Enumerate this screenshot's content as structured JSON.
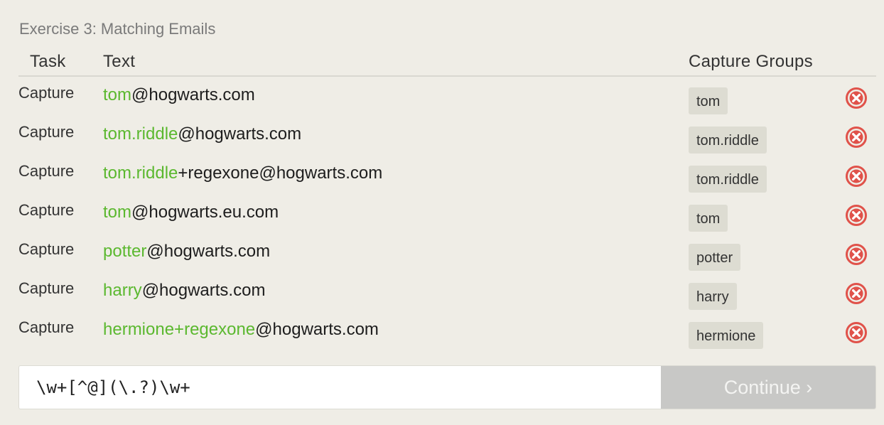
{
  "exercise": {
    "title": "Exercise 3: Matching Emails"
  },
  "table": {
    "headers": {
      "task": "Task",
      "text": "Text",
      "groups": "Capture Groups"
    },
    "rows": [
      {
        "task": "Capture",
        "match": "tom",
        "rest": "@hogwarts.com",
        "group": "tom",
        "status": "error"
      },
      {
        "task": "Capture",
        "match": "tom.riddle",
        "rest": "@hogwarts.com",
        "group": "tom.riddle",
        "status": "error"
      },
      {
        "task": "Capture",
        "match": "tom.riddle",
        "rest": "+regexone@hogwarts.com",
        "group": "tom.riddle",
        "status": "error"
      },
      {
        "task": "Capture",
        "match": "tom",
        "rest": "@hogwarts.eu.com",
        "group": "tom",
        "status": "error"
      },
      {
        "task": "Capture",
        "match": "potter",
        "rest": "@hogwarts.com",
        "group": "potter",
        "status": "error"
      },
      {
        "task": "Capture",
        "match": "harry",
        "rest": "@hogwarts.com",
        "group": "harry",
        "status": "error"
      },
      {
        "task": "Capture",
        "match": "hermione+regexone",
        "rest": "@hogwarts.com",
        "group": "hermione",
        "status": "error"
      }
    ]
  },
  "input": {
    "value": "\\w+[^@](\\.?)\\w+"
  },
  "continue_button": {
    "label": "Continue ›"
  },
  "colors": {
    "match_highlight": "#5bb82f",
    "error_icon": "#e0524a",
    "background": "#efede6"
  }
}
